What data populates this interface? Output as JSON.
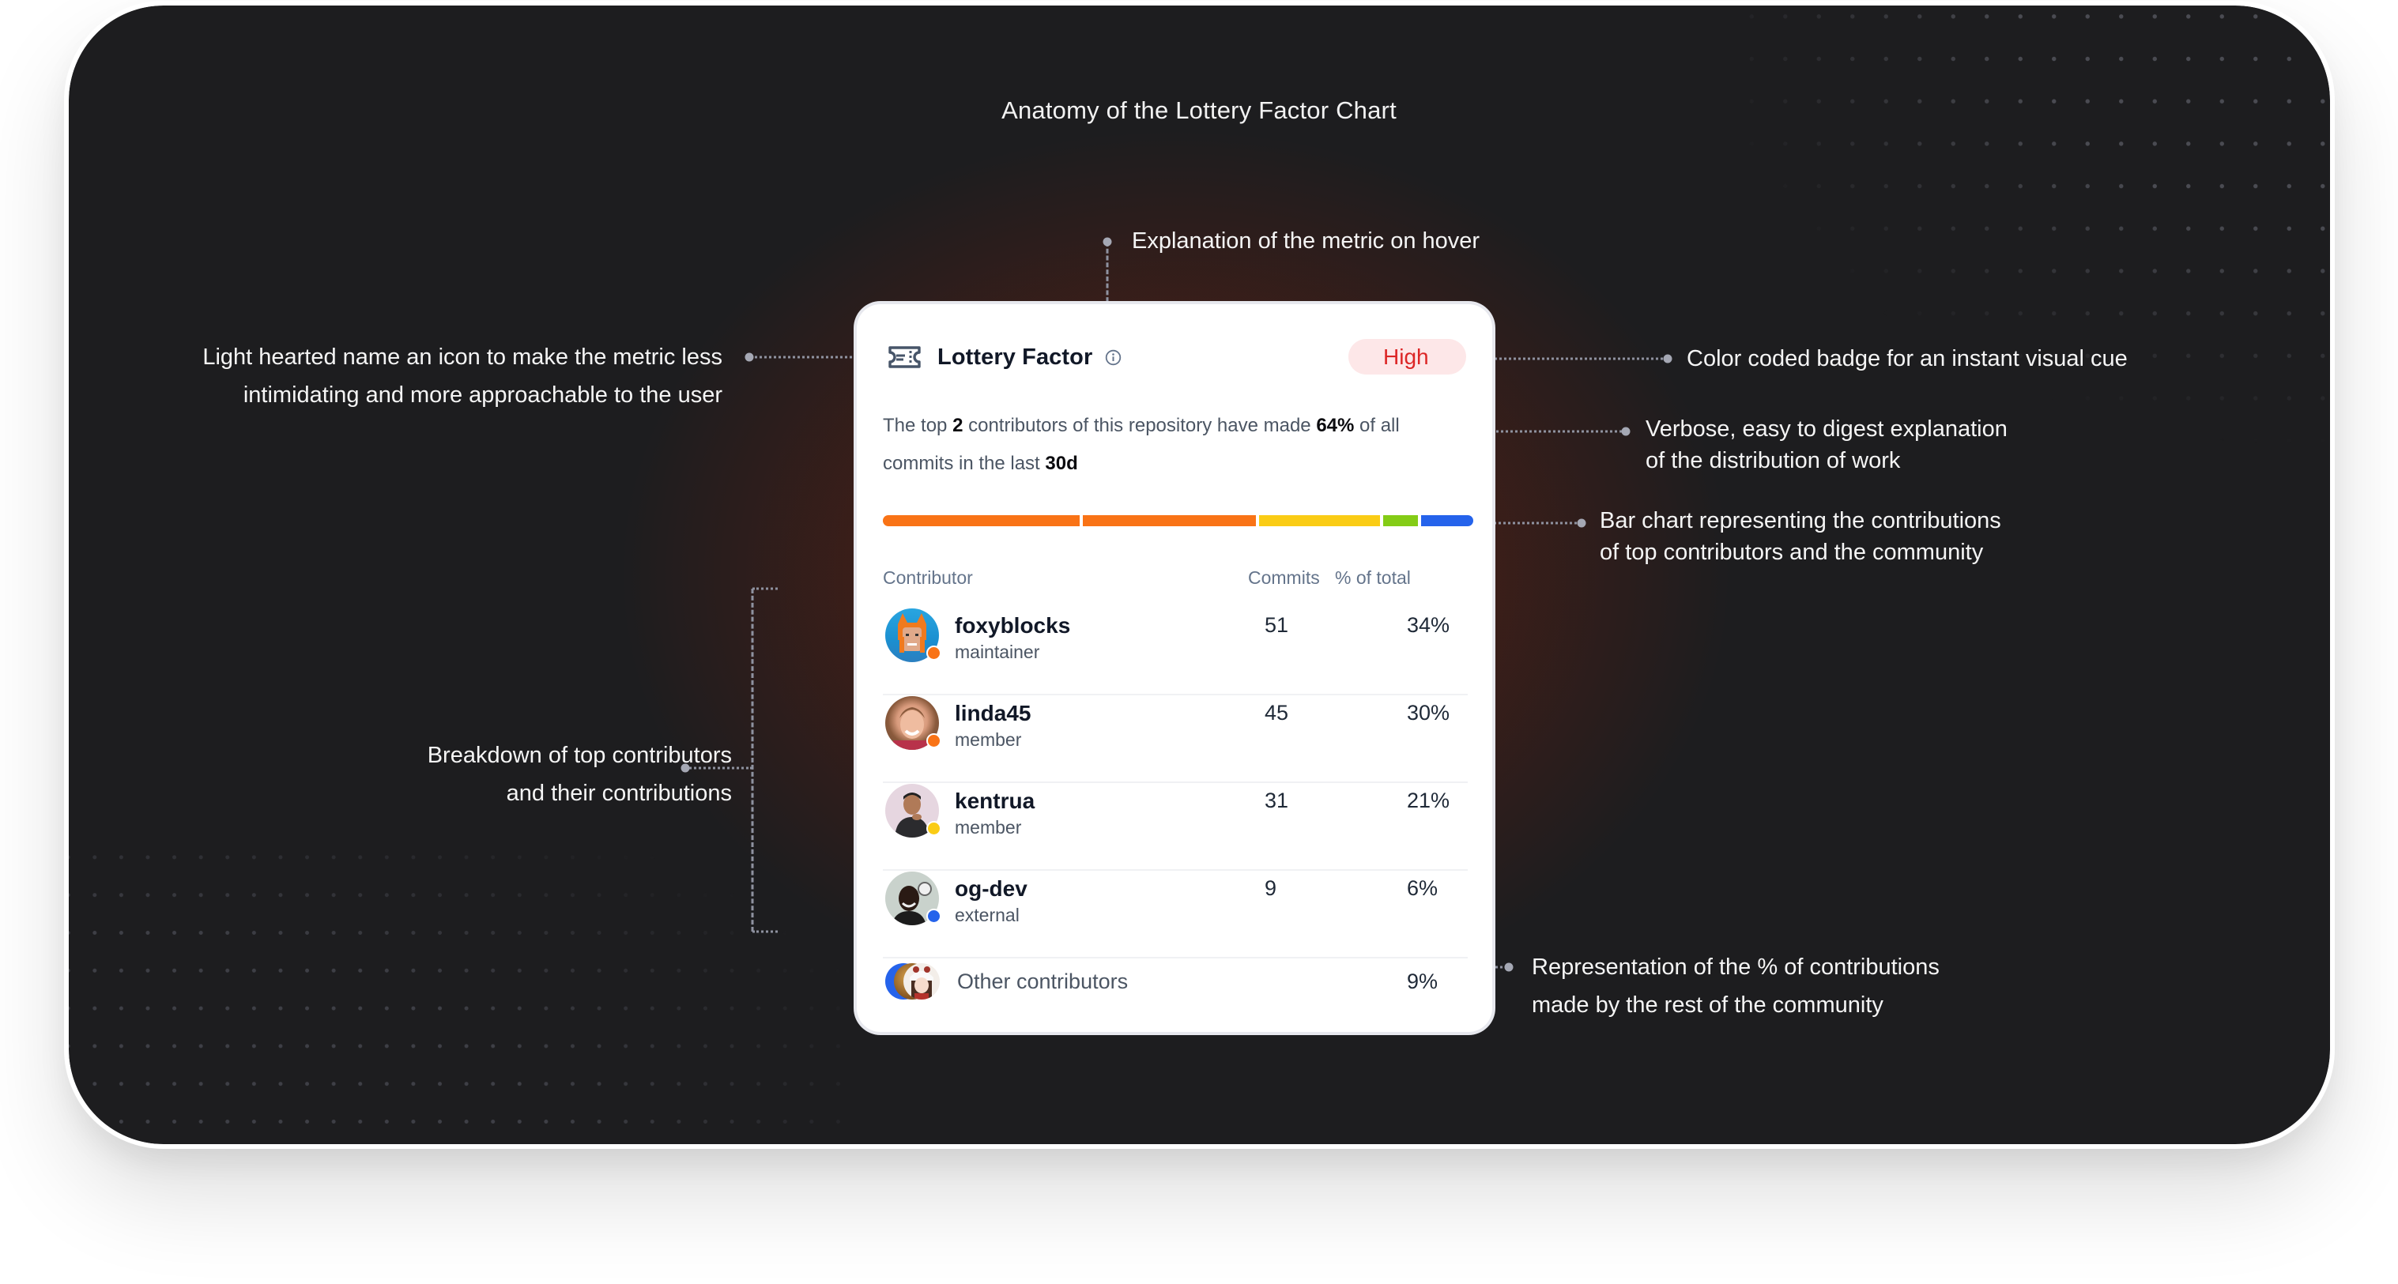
{
  "title": "Anatomy of the Lottery Factor Chart",
  "annotations": {
    "hover_explanation": "Explanation of the metric on hover",
    "name_icon": [
      "Light hearted name an icon to make the metric less",
      "intimidating and more approachable to the user"
    ],
    "badge": "Color coded badge for an instant visual cue",
    "verbose": [
      "Verbose, easy to digest explanation",
      "of the distribution of work"
    ],
    "bar_chart": [
      "Bar chart representing the contributions",
      "of top contributors and the community"
    ],
    "breakdown": [
      "Breakdown of top contributors",
      "and their contributions"
    ],
    "representation": [
      "Representation of the % of contributions",
      "made by the rest of the community"
    ]
  },
  "card": {
    "icon": "ticket-icon",
    "title": "Lottery Factor",
    "info_icon": "info-icon",
    "badge": {
      "label": "High",
      "bg": "#fde7e8",
      "color": "#dc2626"
    },
    "summary": {
      "pre": "The top ",
      "top_count": "2",
      "mid": " contributors of this repository have made ",
      "percent": "64%",
      "post": " of all commits in the last ",
      "period": "30d"
    },
    "table": {
      "headers": {
        "contributor": "Contributor",
        "commits": "Commits",
        "percent": "% of total"
      },
      "rows": [
        {
          "name": "foxyblocks",
          "role": "maintainer",
          "commits": "51",
          "percent": "34%",
          "color": "#f97316"
        },
        {
          "name": "linda45",
          "role": "member",
          "commits": "45",
          "percent": "30%",
          "color": "#f97316"
        },
        {
          "name": "kentrua",
          "role": "member",
          "commits": "31",
          "percent": "21%",
          "color": "#facc15"
        },
        {
          "name": "og-dev",
          "role": "external",
          "commits": "9",
          "percent": "6%",
          "color": "#2563eb"
        }
      ],
      "other": {
        "label": "Other contributors",
        "percent": "9%"
      }
    }
  },
  "chart_data": {
    "type": "bar",
    "orientation": "horizontal-stacked",
    "title": "Lottery Factor",
    "categories": [
      "foxyblocks",
      "linda45",
      "kentrua",
      "og-dev",
      "Other contributors"
    ],
    "values": [
      34,
      30,
      21,
      6,
      9
    ],
    "colors": [
      "#f97316",
      "#f97316",
      "#facc15",
      "#84cc16",
      "#2563eb"
    ],
    "unit": "% of total commits",
    "xlabel": "",
    "ylabel": ""
  }
}
